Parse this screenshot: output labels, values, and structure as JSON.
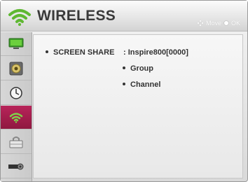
{
  "header": {
    "title": "WIRELESS",
    "hint_move": "Move",
    "hint_ok": "OK"
  },
  "sidebar": {
    "items": [
      {
        "icon": "tv-picture-icon"
      },
      {
        "icon": "speaker-icon"
      },
      {
        "icon": "clock-icon"
      },
      {
        "icon": "wifi-icon",
        "selected": true
      },
      {
        "icon": "lock-icon"
      },
      {
        "icon": "option-icon"
      }
    ]
  },
  "menu": {
    "screen_share_label": "SCREEN SHARE",
    "screen_share_value": ": Inspire800[0000]",
    "group_label": "Group",
    "channel_label": "Channel"
  },
  "colors": {
    "selected_item": "#a81e4f",
    "wifi_green": "#5fb832"
  }
}
